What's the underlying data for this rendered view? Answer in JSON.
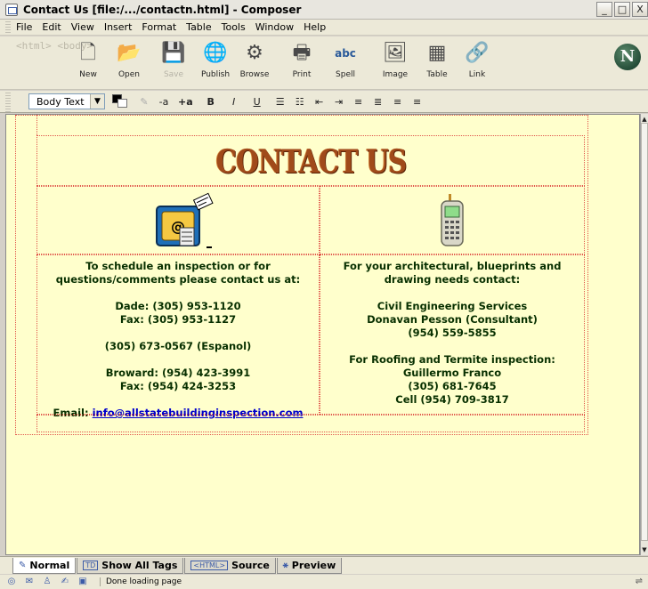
{
  "window": {
    "title": "Contact Us [file:/.../contactn.html] - Composer",
    "minimize": "_",
    "maximize": "□",
    "close": "X"
  },
  "menubar": [
    "File",
    "Edit",
    "View",
    "Insert",
    "Format",
    "Table",
    "Tools",
    "Window",
    "Help"
  ],
  "toolbar": {
    "tag_label": "<html> <body>",
    "buttons": [
      {
        "label": "New",
        "icon": "new-page-icon",
        "glyph": "🗋",
        "enabled": true
      },
      {
        "label": "Open",
        "icon": "folder-open-icon",
        "glyph": "📂",
        "enabled": true
      },
      {
        "label": "Save",
        "icon": "save-icon",
        "glyph": "💾",
        "enabled": false
      },
      {
        "label": "Publish",
        "icon": "publish-icon",
        "glyph": "🌐",
        "enabled": true
      },
      {
        "label": "Browse",
        "icon": "browse-icon",
        "glyph": "⚙",
        "enabled": true
      },
      {
        "label": "Print",
        "icon": "print-icon",
        "glyph": "🖶",
        "enabled": true
      },
      {
        "label": "Spell",
        "icon": "spell-check-icon",
        "glyph": "abc",
        "enabled": true
      },
      {
        "label": "Image",
        "icon": "image-icon",
        "glyph": "🖼",
        "enabled": true
      },
      {
        "label": "Table",
        "icon": "table-icon",
        "glyph": "▦",
        "enabled": true
      },
      {
        "label": "Link",
        "icon": "link-icon",
        "glyph": "🔗",
        "enabled": true
      }
    ]
  },
  "formatbar": {
    "paragraph_style": "Body Text",
    "buttons": [
      "-a",
      "+a",
      "B",
      "I",
      "U",
      "☰",
      "☷",
      "⇤",
      "⇥",
      "≡",
      "≣",
      "≡",
      "≡"
    ]
  },
  "page": {
    "heading": "CONTACT US",
    "left": {
      "lines": [
        "To schedule an inspection or for",
        "questions/comments please contact us at:",
        "",
        "Dade: (305) 953-1120",
        "Fax: (305) 953-1127",
        "",
        "(305) 673-0567 (Espanol)",
        "",
        "Broward: (954) 423-3991",
        "Fax: (954) 424-3253",
        ""
      ],
      "email_label": "Email:",
      "email_link": "info@allstatebuildinginspection.com"
    },
    "right": {
      "lines": [
        "For your architectural, blueprints and",
        "drawing needs contact:",
        "",
        "Civil Engineering Services",
        "Donavan Pesson (Consultant)",
        "(954) 559-5855",
        "",
        "For Roofing and Termite inspection:",
        "Guillermo Franco",
        "(305) 681-7645",
        "Cell (954) 709-3817"
      ]
    }
  },
  "modetabs": [
    {
      "label": "Normal",
      "active": true
    },
    {
      "label": "Show All Tags",
      "active": false
    },
    {
      "label": "Source",
      "active": false
    },
    {
      "label": "Preview",
      "active": false
    }
  ],
  "modetab_tags": {
    "show_all_tags": "TD",
    "source": "<HTML>"
  },
  "statusbar": {
    "text": "Done loading page"
  },
  "colors": {
    "page_background": "#ffffcc",
    "text": "#083000",
    "link": "#0000cc",
    "table_border": "#e0564b"
  }
}
